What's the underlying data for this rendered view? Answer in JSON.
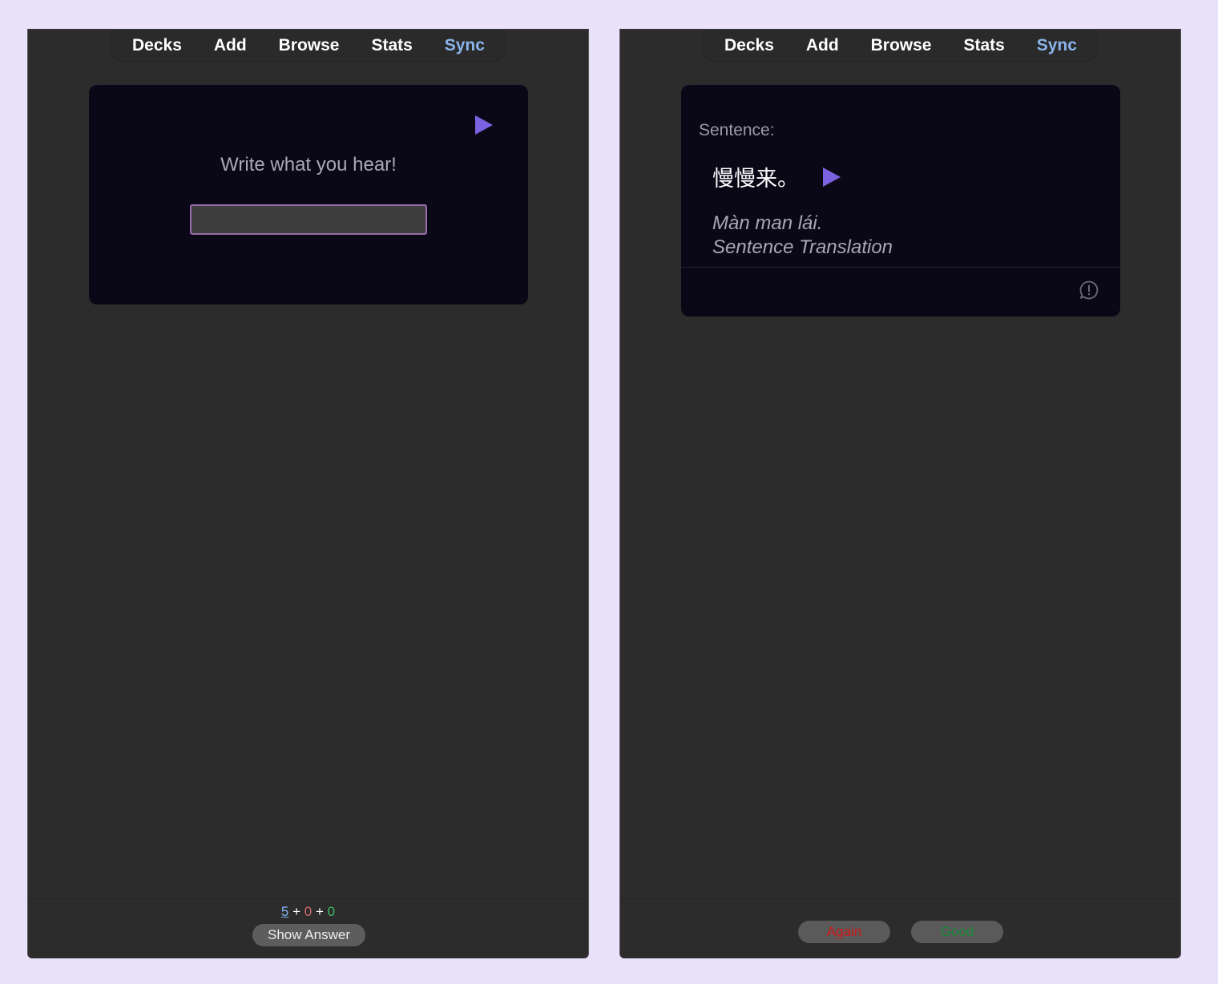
{
  "nav": {
    "items": [
      {
        "label": "Decks"
      },
      {
        "label": "Add"
      },
      {
        "label": "Browse"
      },
      {
        "label": "Stats"
      },
      {
        "label": "Sync"
      }
    ],
    "sync_color": "#8ab4ec"
  },
  "question": {
    "prompt": "Write what you hear!",
    "input_value": "",
    "play_icon": "play-audio-icon",
    "counts": {
      "new": "5",
      "plus1": "+",
      "learning": "0",
      "plus2": "+",
      "review": "0"
    },
    "show_answer_label": "Show Answer"
  },
  "answer": {
    "label": "Sentence:",
    "hanzi": "慢慢来。",
    "pinyin": "Màn man lái.",
    "translation": "Sentence Translation",
    "play_icon": "play-audio-icon",
    "report_icon": "report-message-icon",
    "again_label": "Again",
    "good_label": "Good"
  },
  "colors": {
    "accent_play": "#7b62e0",
    "card_bg": "#0a0817",
    "panel_bg": "#2c2c2c",
    "again": "#d21818",
    "good": "#1b8a3a"
  }
}
